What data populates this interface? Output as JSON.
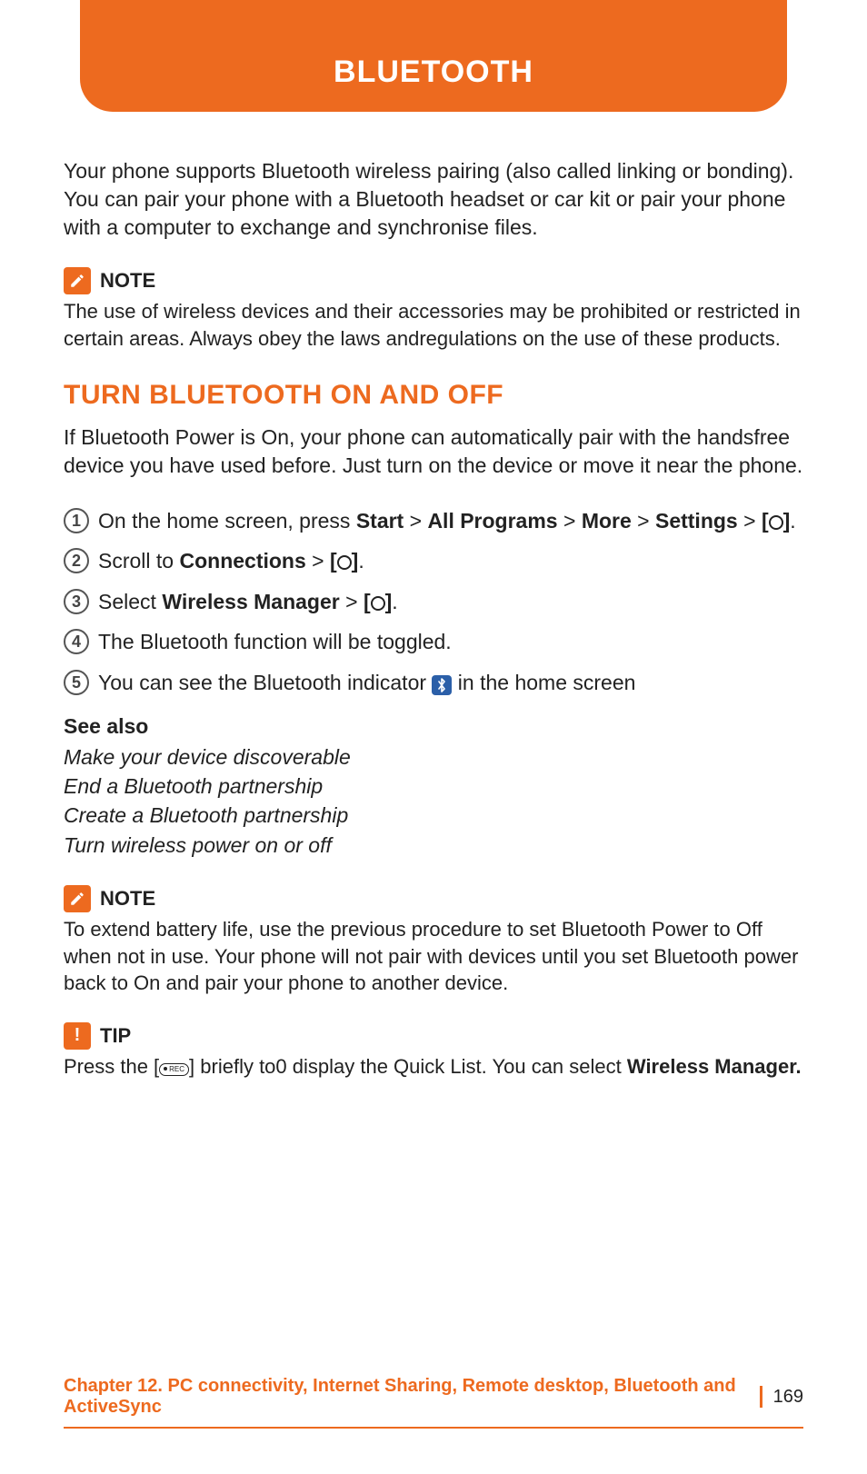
{
  "header": {
    "title": "BLUETOOTH"
  },
  "intro": "Your phone supports Bluetooth wireless pairing (also called linking or bonding). You can pair your phone with a Bluetooth headset or car kit or pair your phone with a computer to exchange and synchronise files.",
  "note1": {
    "label": "NOTE",
    "text": "The use of wireless devices and their accessories may be prohibited or restricted in certain areas. Always obey the laws andregulations on the use of these products."
  },
  "section1": {
    "heading": "TURN BLUETOOTH ON AND OFF",
    "intro": "If Bluetooth Power is On, your phone can automatically pair with the handsfree device you have used before. Just turn on the device or move it near the phone.",
    "steps": {
      "s1_a": "On the home screen, press ",
      "s1_start": "Start",
      "s1_gt1": " > ",
      "s1_allprog": "All Programs",
      "s1_gt2": " > ",
      "s1_more": "More",
      "s1_gt3": " > ",
      "s1_settings": "Settings",
      "s1_b": " > ",
      "s1_brkt_open": "[",
      "s1_brkt_close": "]",
      "s1_period": ".",
      "s2_a": "Scroll to ",
      "s2_conn": "Connections",
      "s2_b": " > ",
      "s3_a": "Select ",
      "s3_wm": "Wireless Manager",
      "s3_b": " > ",
      "s4": "The Bluetooth function will be toggled.",
      "s5_a": "You can see the Bluetooth indicator ",
      "s5_b": " in the home screen"
    }
  },
  "see_also": {
    "title": "See also",
    "items": [
      "Make your device discoverable",
      "End a Bluetooth partnership",
      "Create a Bluetooth partnership",
      "Turn wireless power on or off"
    ]
  },
  "note2": {
    "label": "NOTE",
    "text": "To extend battery life, use the previous procedure to set Bluetooth Power to Off when not in use. Your phone will not pair with devices until you set Bluetooth power back to On and pair your phone to another device."
  },
  "tip": {
    "label": "TIP",
    "pre": "Press the [",
    "mid": "] briefly to0 display the Quick List. You can select ",
    "bold": "Wireless Manager."
  },
  "footer": {
    "chapter": "Chapter 12. PC connectivity, Internet Sharing, Remote desktop, Bluetooth and ActiveSync",
    "page": "169"
  }
}
